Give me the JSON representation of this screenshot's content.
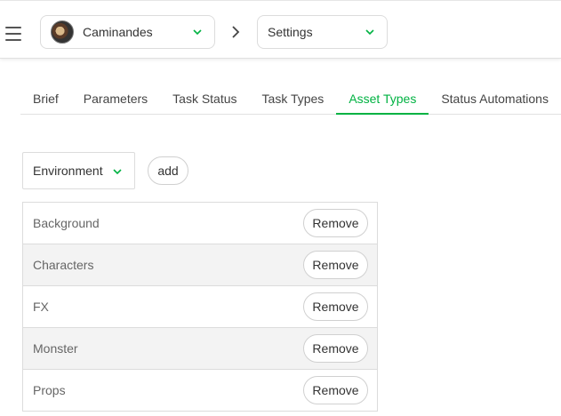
{
  "header": {
    "menu_icon": "hamburger-menu-icon",
    "production": {
      "name": "Caminandes",
      "avatar_icon": "production-avatar"
    },
    "separator_icon": "chevron-right-icon",
    "section": {
      "label": "Settings"
    },
    "accent_color": "#00b242"
  },
  "tabs": [
    {
      "label": "Brief"
    },
    {
      "label": "Parameters"
    },
    {
      "label": "Task Status"
    },
    {
      "label": "Task Types"
    },
    {
      "label": "Asset Types",
      "active": true
    },
    {
      "label": "Status Automations"
    }
  ],
  "toolbar": {
    "asset_type_select": "Environment",
    "add_label": "add"
  },
  "asset_types": [
    {
      "name": "Background",
      "remove_label": "Remove"
    },
    {
      "name": "Characters",
      "remove_label": "Remove"
    },
    {
      "name": "FX",
      "remove_label": "Remove"
    },
    {
      "name": "Monster",
      "remove_label": "Remove"
    },
    {
      "name": "Props",
      "remove_label": "Remove"
    }
  ]
}
